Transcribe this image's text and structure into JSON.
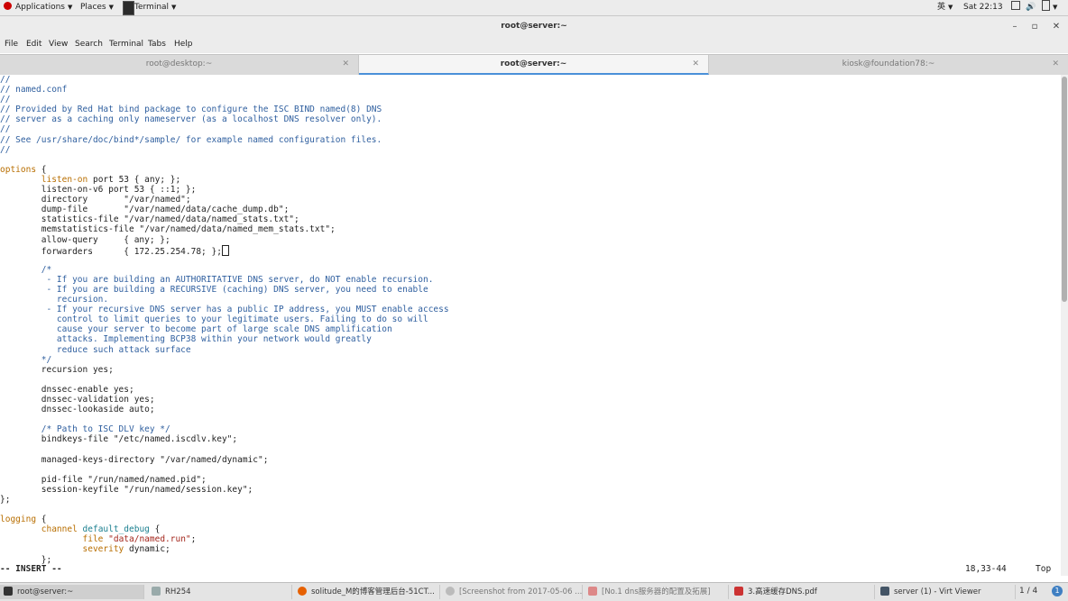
{
  "topbar": {
    "applications": "Applications",
    "places": "Places",
    "terminal": "Terminal",
    "input_method": "英",
    "clock": "Sat 22:13",
    "icons": [
      "window-icon",
      "volume-icon",
      "battery-icon"
    ]
  },
  "window": {
    "title": "root@server:~"
  },
  "menubar": [
    "File",
    "Edit",
    "View",
    "Search",
    "Terminal",
    "Tabs",
    "Help"
  ],
  "tabs": [
    {
      "label": "root@desktop:~",
      "active": false
    },
    {
      "label": "root@server:~",
      "active": true
    },
    {
      "label": "kiosk@foundation78:~",
      "active": false
    }
  ],
  "editor": {
    "lines": [
      [
        {
          "t": "//",
          "c": "com"
        }
      ],
      [
        {
          "t": "// named.conf",
          "c": "com"
        }
      ],
      [
        {
          "t": "//",
          "c": "com"
        }
      ],
      [
        {
          "t": "// Provided by Red Hat bind package to configure the ISC BIND named(8) DNS",
          "c": "com"
        }
      ],
      [
        {
          "t": "// server as a caching only nameserver (as a localhost DNS resolver only).",
          "c": "com"
        }
      ],
      [
        {
          "t": "//",
          "c": "com"
        }
      ],
      [
        {
          "t": "// See /usr/share/doc/bind*/sample/ for example named configuration files.",
          "c": "com"
        }
      ],
      [
        {
          "t": "//",
          "c": "com"
        }
      ],
      [],
      [
        {
          "t": "options",
          "c": "key"
        },
        {
          "t": " {",
          "c": "txt"
        }
      ],
      [
        {
          "t": "        ",
          "c": "txt"
        },
        {
          "t": "listen-on",
          "c": "key"
        },
        {
          "t": " port 53 { any; };",
          "c": "txt"
        }
      ],
      [
        {
          "t": "        listen-on-v6 port 53 { ::1; };",
          "c": "txt"
        }
      ],
      [
        {
          "t": "        directory       \"/var/named\";",
          "c": "txt"
        }
      ],
      [
        {
          "t": "        dump-file       \"/var/named/data/cache_dump.db\";",
          "c": "txt"
        }
      ],
      [
        {
          "t": "        statistics-file \"/var/named/data/named_stats.txt\";",
          "c": "txt"
        }
      ],
      [
        {
          "t": "        memstatistics-file \"/var/named/data/named_mem_stats.txt\";",
          "c": "txt"
        }
      ],
      [
        {
          "t": "        allow-query     { any; };",
          "c": "txt"
        }
      ],
      [
        {
          "t": "        forwarders      { 172.25.254.78; };",
          "c": "txt"
        },
        {
          "t": "",
          "c": "cursor"
        }
      ],
      [],
      [
        {
          "t": "        /*",
          "c": "com"
        }
      ],
      [
        {
          "t": "         - If you are building an AUTHORITATIVE DNS server, do NOT enable recursion.",
          "c": "com"
        }
      ],
      [
        {
          "t": "         - If you are building a RECURSIVE (caching) DNS server, you need to enable",
          "c": "com"
        }
      ],
      [
        {
          "t": "           recursion.",
          "c": "com"
        }
      ],
      [
        {
          "t": "         - If your recursive DNS server has a public IP address, you MUST enable access",
          "c": "com"
        }
      ],
      [
        {
          "t": "           control to limit queries to your legitimate users. Failing to do so will",
          "c": "com"
        }
      ],
      [
        {
          "t": "           cause your server to become part of large scale DNS amplification",
          "c": "com"
        }
      ],
      [
        {
          "t": "           attacks. Implementing BCP38 within your network would greatly",
          "c": "com"
        }
      ],
      [
        {
          "t": "           reduce such attack surface",
          "c": "com"
        }
      ],
      [
        {
          "t": "        */",
          "c": "com"
        }
      ],
      [
        {
          "t": "        recursion yes;",
          "c": "txt"
        }
      ],
      [],
      [
        {
          "t": "        dnssec-enable yes;",
          "c": "txt"
        }
      ],
      [
        {
          "t": "        dnssec-validation yes;",
          "c": "txt"
        }
      ],
      [
        {
          "t": "        dnssec-lookaside auto;",
          "c": "txt"
        }
      ],
      [],
      [
        {
          "t": "        /* Path to ISC DLV key */",
          "c": "com"
        }
      ],
      [
        {
          "t": "        bindkeys-file \"/etc/named.iscdlv.key\";",
          "c": "txt"
        }
      ],
      [],
      [
        {
          "t": "        managed-keys-directory \"/var/named/dynamic\";",
          "c": "txt"
        }
      ],
      [],
      [
        {
          "t": "        pid-file \"/run/named/named.pid\";",
          "c": "txt"
        }
      ],
      [
        {
          "t": "        session-keyfile \"/run/named/session.key\";",
          "c": "txt"
        }
      ],
      [
        {
          "t": "};",
          "c": "txt"
        }
      ],
      [],
      [
        {
          "t": "logging",
          "c": "key"
        },
        {
          "t": " {",
          "c": "txt"
        }
      ],
      [
        {
          "t": "        ",
          "c": "txt"
        },
        {
          "t": "channel",
          "c": "key"
        },
        {
          "t": " ",
          "c": "txt"
        },
        {
          "t": "default_debug",
          "c": "typ"
        },
        {
          "t": " {",
          "c": "txt"
        }
      ],
      [
        {
          "t": "                ",
          "c": "txt"
        },
        {
          "t": "file",
          "c": "key"
        },
        {
          "t": " ",
          "c": "txt"
        },
        {
          "t": "\"data/named.run\"",
          "c": "str"
        },
        {
          "t": ";",
          "c": "txt"
        }
      ],
      [
        {
          "t": "                ",
          "c": "txt"
        },
        {
          "t": "severity",
          "c": "key"
        },
        {
          "t": " dynamic;",
          "c": "txt"
        }
      ],
      [
        {
          "t": "        };",
          "c": "txt"
        }
      ]
    ],
    "mode": "-- INSERT --",
    "cursor_pos": "18,33-44",
    "scroll_pos": "Top"
  },
  "taskbar": {
    "items": [
      {
        "label": "root@server:~",
        "icon": "terminal-icon",
        "active": true
      },
      {
        "label": "RH254",
        "icon": "folder-icon",
        "active": false
      },
      {
        "label": "solitude_M的博客管理后台-51CT...",
        "icon": "firefox-icon",
        "active": false
      },
      {
        "label": "[Screenshot from 2017-05-06 ...",
        "icon": "search-icon",
        "active": false
      },
      {
        "label": "[No.1 dns服务器的配置及拓展]",
        "icon": "document-icon",
        "active": false
      },
      {
        "label": "3.高速缓存DNS.pdf",
        "icon": "pdf-icon",
        "active": false
      },
      {
        "label": "server (1) - Virt Viewer",
        "icon": "monitor-icon",
        "active": false
      }
    ],
    "workspace": "1 / 4",
    "info_badge": "1"
  }
}
